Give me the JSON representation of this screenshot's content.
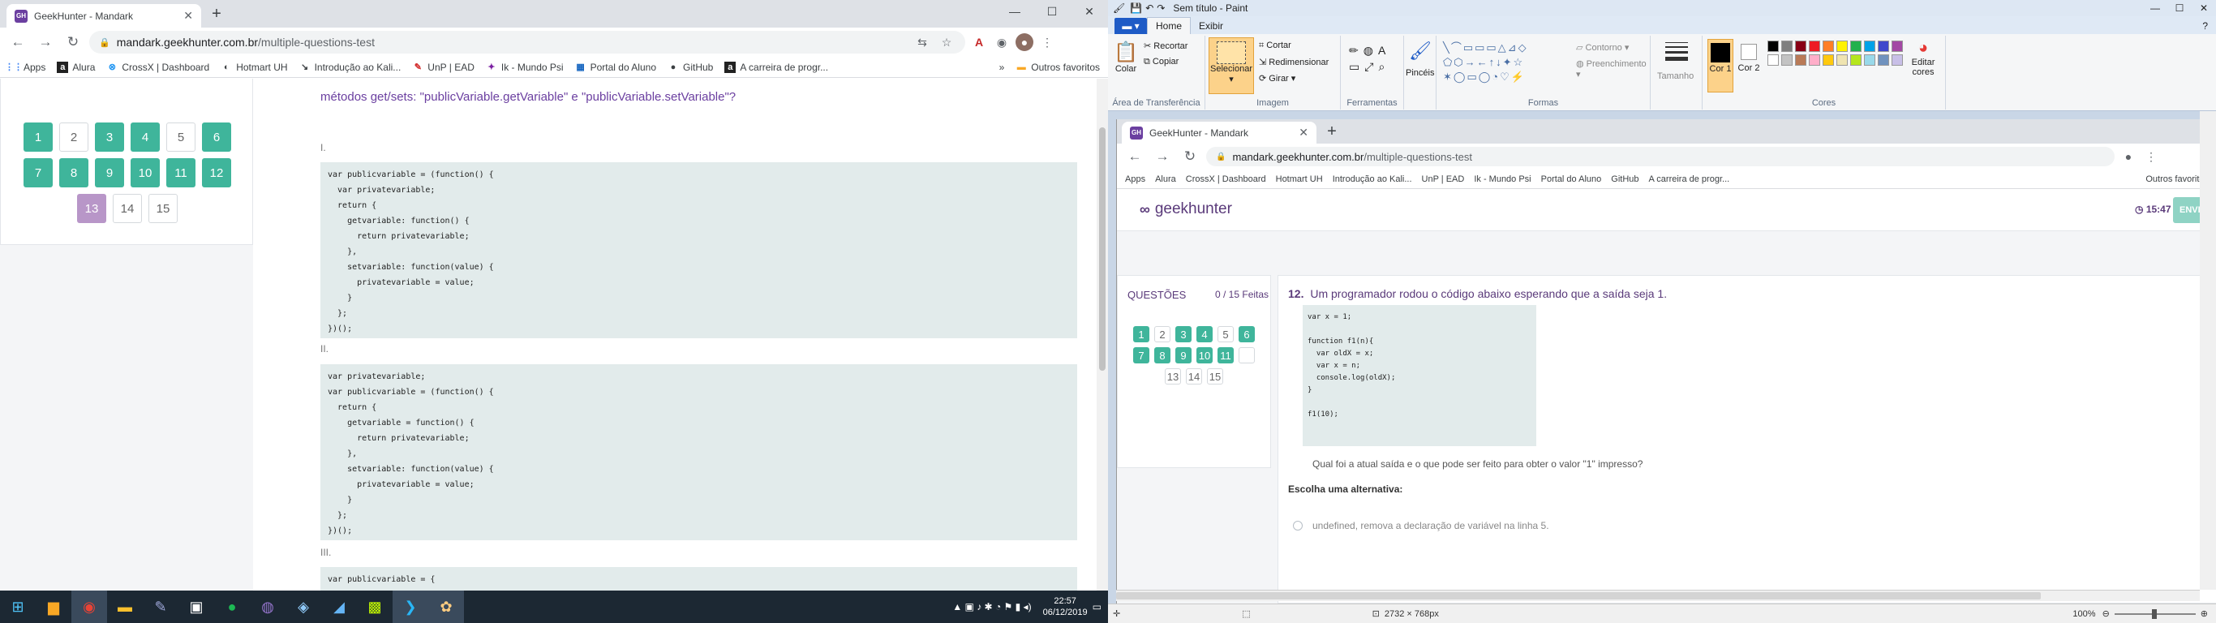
{
  "left_browser": {
    "tab_title": "GeekHunter - Mandark",
    "favicon_text": "GH",
    "url_domain": "mandark.geekhunter.com.br",
    "url_path": "/multiple-questions-test",
    "bookmarks": [
      "Apps",
      "Alura",
      "CrossX | Dashboard",
      "Hotmart UH",
      "Introdução ao Kali...",
      "UnP | EAD",
      "Ik - Mundo Psi",
      "Portal do Aluno",
      "GitHub",
      "A carreira de progr..."
    ],
    "other_favorites": "Outros favoritos",
    "question_buttons": [
      "1",
      "2",
      "3",
      "4",
      "5",
      "6",
      "7",
      "8",
      "9",
      "10",
      "11",
      "12",
      "13",
      "14",
      "15"
    ],
    "question_heading": "métodos get/sets: \"publicVariable.getVariable\" e \"publicVariable.setVariable\"?",
    "options": [
      {
        "label": "I.",
        "code": "var publicvariable = (function() {\n  var privatevariable;\n  return {\n    getvariable: function() {\n      return privatevariable;\n    },\n    setvariable: function(value) {\n      privatevariable = value;\n    }\n  };\n})();"
      },
      {
        "label": "II.",
        "code": "var privatevariable;\nvar publicvariable = (function() {\n  return {\n    getvariable = function() {\n      return privatevariable;\n    },\n    setvariable: function(value) {\n      privatevariable = value;\n    }\n  };\n})();"
      },
      {
        "label": "III.",
        "code": "var publicvariable = {"
      }
    ]
  },
  "taskbar": {
    "time": "22:57",
    "date": "06/12/2019"
  },
  "paint": {
    "title": "Sem título - Paint",
    "menu_tabs": [
      "Home",
      "Exibir"
    ],
    "groups": {
      "clipboard": {
        "paste": "Colar",
        "cut": "Recortar",
        "copy": "Copiar",
        "label": "Área de Transferência"
      },
      "image": {
        "select": "Selecionar",
        "crop": "Cortar",
        "resize": "Redimensionar",
        "rotate": "Girar",
        "label": "Imagem"
      },
      "tools": {
        "label": "Ferramentas"
      },
      "brushes": {
        "label": "Pincéis"
      },
      "shapes": {
        "outline": "Contorno",
        "fill": "Preenchimento",
        "label": "Formas"
      },
      "size": {
        "label": "Tamanho"
      },
      "colors": {
        "color1": "Cor 1",
        "color2": "Cor 2",
        "edit": "Editar cores",
        "label": "Cores"
      }
    },
    "palette": [
      "#000000",
      "#7f7f7f",
      "#880015",
      "#ed1c24",
      "#ff7f27",
      "#fff200",
      "#22b14c",
      "#00a2e8",
      "#3f48cc",
      "#a349a4",
      "#ffffff",
      "#c3c3c3",
      "#b97a57",
      "#ffaec9",
      "#ffc90e",
      "#efe4b0",
      "#b5e61d",
      "#99d9ea",
      "#7092be",
      "#c8bfe7"
    ],
    "status_size": "2732 × 768px",
    "zoom": "100%"
  },
  "nested": {
    "tab_title": "GeekHunter - Mandark",
    "url_domain": "mandark.geekhunter.com.br",
    "url_path": "/multiple-questions-test",
    "brand": "geekhunter",
    "timer": "15:47",
    "submit": "ENVIAR TESTE",
    "questions_label": "QUESTÕES",
    "progress": "0 / 15 Feitas",
    "question_number": "12.",
    "question_text": "Um programador rodou o código abaixo esperando que a saída seja 1.",
    "code": "var x = 1;\n\nfunction f1(n){\n  var oldX = x;\n  var x = n;\n  console.log(oldX);\n}\n\nf1(10);",
    "question_followup": "Qual foi a atual saída e o que pode ser feito para obter o valor \"1\" impresso?",
    "choose": "Escolha uma alternativa:",
    "alternative_1": "undefined, remova a declaração de variável na linha 5."
  }
}
